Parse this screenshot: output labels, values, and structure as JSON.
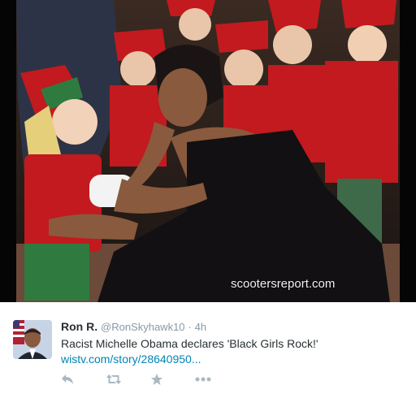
{
  "photo": {
    "watermark": "scootersreport.com"
  },
  "tweet": {
    "display_name": "Ron R.",
    "handle": "@RonSkyhawk10",
    "separator": "·",
    "timestamp": "4h",
    "text": "Racist Michelle Obama declares 'Black Girls Rock!'",
    "link": "wistv.com/story/28640950..."
  },
  "actions": [
    "reply-icon",
    "retweet-icon",
    "favorite-icon",
    "more-icon"
  ],
  "colors": {
    "name": "#292f33",
    "meta": "#8899a6",
    "link": "#0084b4",
    "action_icons": "#aab8c2"
  }
}
